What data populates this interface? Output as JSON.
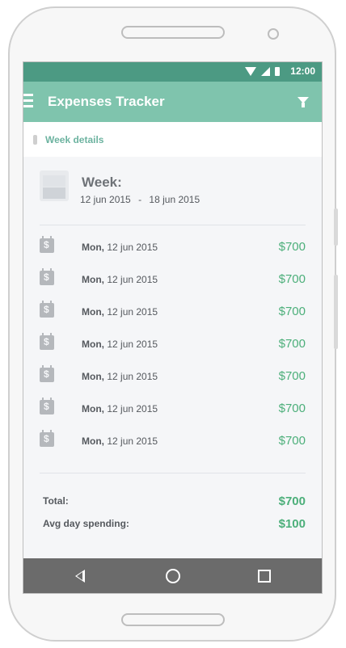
{
  "status_bar": {
    "time": "12:00",
    "icons": [
      "wifi-icon",
      "signal-icon",
      "battery-icon"
    ]
  },
  "app_bar": {
    "title": "Expenses Tracker",
    "menu_icon": "menu-icon",
    "filter_icon": "filter-icon"
  },
  "tab": {
    "label": "Week details"
  },
  "week": {
    "title": "Week:",
    "start": "12 jun 2015",
    "separator": "-",
    "end": "18 jun 2015"
  },
  "days": [
    {
      "weekday": "Mon,",
      "date": "12 jun 2015",
      "amount": "$700"
    },
    {
      "weekday": "Mon,",
      "date": "12 jun 2015",
      "amount": "$700"
    },
    {
      "weekday": "Mon,",
      "date": "12 jun 2015",
      "amount": "$700"
    },
    {
      "weekday": "Mon,",
      "date": "12 jun 2015",
      "amount": "$700"
    },
    {
      "weekday": "Mon,",
      "date": "12 jun 2015",
      "amount": "$700"
    },
    {
      "weekday": "Mon,",
      "date": "12 jun 2015",
      "amount": "$700"
    },
    {
      "weekday": "Mon,",
      "date": "12 jun 2015",
      "amount": "$700"
    }
  ],
  "totals": {
    "total_label": "Total:",
    "total_value": "$700",
    "avg_label": "Avg day spending:",
    "avg_value": "$100"
  },
  "colors": {
    "status_bar": "#4c9a83",
    "app_bar": "#7fc4ad",
    "amount_green": "#4caf7a",
    "nav_bar": "#6b6b6b"
  }
}
